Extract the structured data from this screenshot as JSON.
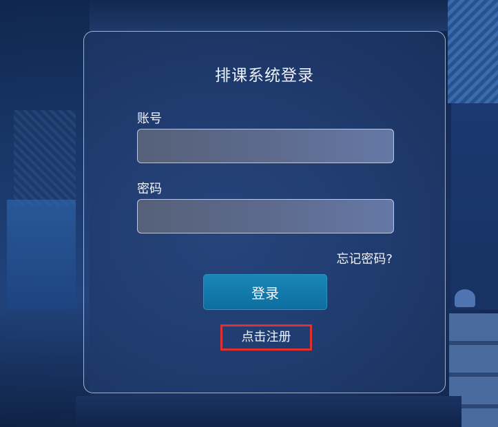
{
  "login": {
    "title": "排课系统登录",
    "username_label": "账号",
    "username_value": "",
    "password_label": "密码",
    "password_value": "",
    "forgot_link": "忘记密码?",
    "login_button": "登录",
    "register_link": "点击注册"
  },
  "colors": {
    "accent_button": "#1a87b8",
    "highlight_box": "#e03131"
  }
}
